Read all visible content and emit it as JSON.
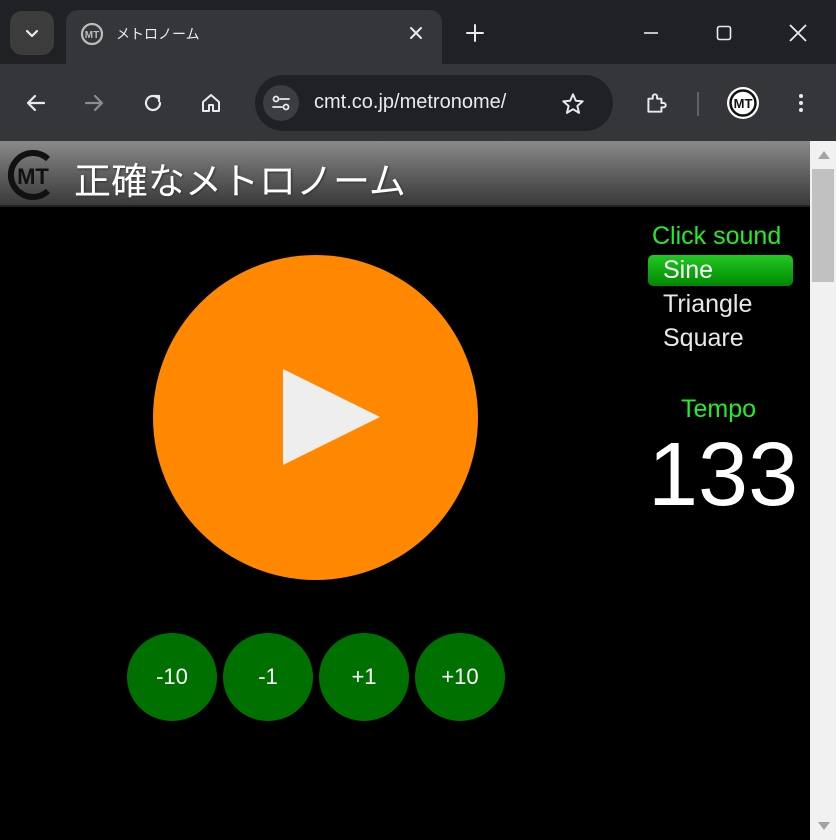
{
  "browser": {
    "tab_title": "メトロノーム",
    "url": "cmt.co.jp/metronome/",
    "logo_text": "MT"
  },
  "header": {
    "title": "正確なメトロノーム",
    "logo_text": "MT"
  },
  "play_button": {
    "icon": "play-icon",
    "color": "#ff8800"
  },
  "tempo_controls": [
    {
      "label": "-10"
    },
    {
      "label": "-1"
    },
    {
      "label": "+1"
    },
    {
      "label": "+10"
    }
  ],
  "click_sound": {
    "heading": "Click sound",
    "options": [
      "Sine",
      "Triangle",
      "Square"
    ],
    "selected": "Sine"
  },
  "tempo": {
    "heading": "Tempo",
    "value": "133"
  },
  "colors": {
    "accent_green": "#22ee22",
    "button_green": "#007100",
    "play_orange": "#ff8800"
  }
}
